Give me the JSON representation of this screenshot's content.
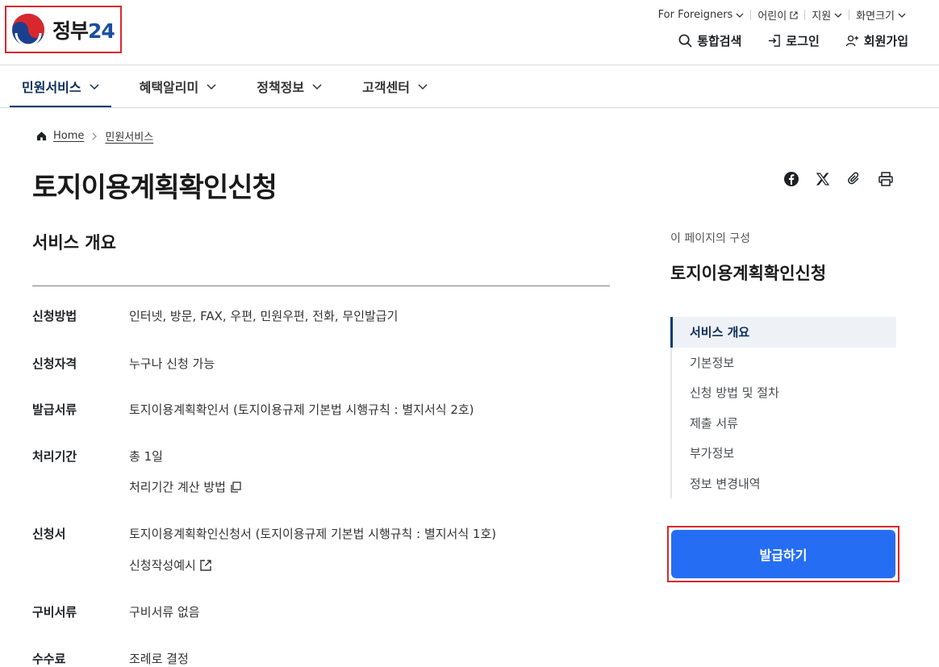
{
  "header": {
    "logo_text": "정부",
    "logo_num": "24",
    "util": [
      {
        "label": "For Foreigners",
        "icon": "chevron-down-icon"
      },
      {
        "label": "어린이",
        "icon": "external-link-icon"
      },
      {
        "label": "지원",
        "icon": "chevron-down-icon"
      },
      {
        "label": "화면크기",
        "icon": "chevron-down-icon"
      }
    ],
    "actions": [
      {
        "label": "통합검색",
        "icon": "search-icon"
      },
      {
        "label": "로그인",
        "icon": "login-icon"
      },
      {
        "label": "회원가입",
        "icon": "add-user-icon"
      }
    ]
  },
  "gnb": [
    {
      "label": "민원서비스"
    },
    {
      "label": "혜택알리미"
    },
    {
      "label": "정책정보"
    },
    {
      "label": "고객센터"
    }
  ],
  "breadcrumb": {
    "home": "Home",
    "current": "민원서비스"
  },
  "page_title": "토지이용계획확인신청",
  "section_title": "서비스 개요",
  "info": {
    "method": {
      "label": "신청방법",
      "value": "인터넷, 방문, FAX, 우편, 민원우편, 전화, 무인발급기"
    },
    "eligibility": {
      "label": "신청자격",
      "value": "누구나 신청 가능"
    },
    "document": {
      "label": "발급서류",
      "value": "토지이용계획확인서 (토지이용규제 기본법 시행규칙 : 별지서식 2호)"
    },
    "period": {
      "label": "처리기간",
      "value": "총 1일",
      "link": "처리기간 계산 방법"
    },
    "form": {
      "label": "신청서",
      "value": "토지이용계획확인신청서 (토지이용규제 기본법 시행규칙 : 별지서식 1호)",
      "link": "신청작성예시"
    },
    "required": {
      "label": "구비서류",
      "value": "구비서류 없음"
    },
    "fee": {
      "label": "수수료",
      "value": "조례로 결정"
    }
  },
  "toc": {
    "caption": "이 페이지의 구성",
    "title": "토지이용계획확인신청",
    "items": [
      "서비스 개요",
      "기본정보",
      "신청 방법 및 절차",
      "제출 서류",
      "부가정보",
      "정보 변경내역"
    ]
  },
  "issue_button": "발급하기",
  "colors": {
    "primary": "#256ef4",
    "navy": "#0b2d5e",
    "highlight": "#d8282e"
  }
}
